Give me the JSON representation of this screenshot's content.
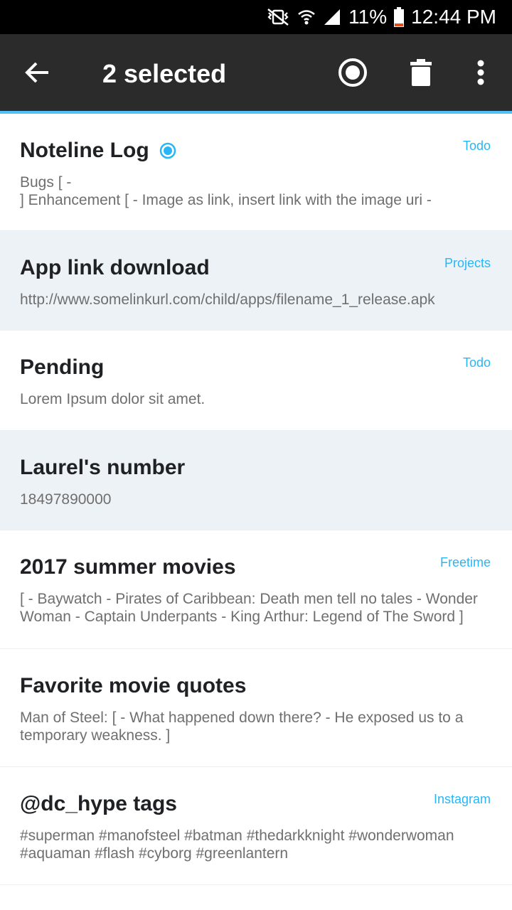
{
  "status_bar": {
    "battery": "11%",
    "time": "12:44 PM",
    "battery_color": "#e64a19"
  },
  "app_bar": {
    "title": "2 selected",
    "background": "#2b2b2b",
    "accent": "#4fc3f7",
    "icons": [
      "back-arrow-icon",
      "select-circle-icon",
      "delete-icon",
      "more-vert-icon"
    ]
  },
  "notes": [
    {
      "title": "Noteline Log",
      "tag": "Todo",
      "snippet": "Bugs  [  -\n ] Enhancement  [  - Image as link, insert link with the image uri -",
      "selected": false,
      "title_icon": "selected-dot-icon"
    },
    {
      "title": "App link download",
      "tag": "Projects",
      "snippet": "http://www.somelinkurl.com/child/apps/filename_1_release.apk",
      "selected": true
    },
    {
      "title": "Pending",
      "tag": "Todo",
      "snippet": "Lorem Ipsum dolor sit amet.",
      "selected": false
    },
    {
      "title": "Laurel's number",
      "tag": "",
      "snippet": "18497890000",
      "selected": true
    },
    {
      "title": "2017 summer movies",
      "tag": "Freetime",
      "snippet": " [  - Baywatch - Pirates of Caribbean: Death men tell no tales - Wonder Woman - Captain Underpants - King Arthur: Legend of The Sword ]",
      "selected": false
    },
    {
      "title": "Favorite movie quotes",
      "tag": "",
      "snippet": "Man of Steel:  [  - What happened down there? - He exposed us to a temporary weakness. ]",
      "selected": false
    },
    {
      "title": "@dc_hype tags",
      "tag": "Instagram",
      "snippet": "#superman #manofsteel #batman #thedarkknight #wonderwoman #aquaman #flash #cyborg #greenlantern",
      "selected": false
    }
  ],
  "colors": {
    "tag": "#29b6f6",
    "selected_row": "#edf2f6"
  }
}
